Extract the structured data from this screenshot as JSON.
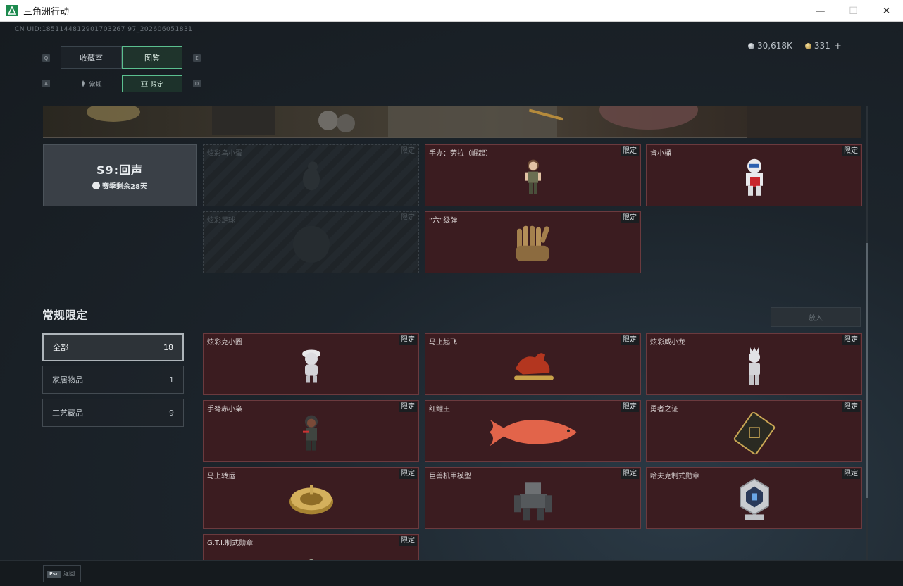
{
  "window": {
    "title": "三角洲行动",
    "minimize": "—",
    "maximize": "☐",
    "close": "✕"
  },
  "header": {
    "uid": "CN UID:1851144812901703267 97_202606051831",
    "silver": "30,618K",
    "gold": "331",
    "plus": "+"
  },
  "tabs": {
    "key_left": "Q",
    "key_right": "E",
    "collection": "收藏室",
    "catalog": "图鉴",
    "sub_key_left": "A",
    "sub_key_right": "D",
    "normal": "常规",
    "limited": "限定"
  },
  "season": {
    "title": "S9:回声",
    "remaining": "赛季剩余28天"
  },
  "tag": "限定",
  "season_items": [
    {
      "name": "炫彩乌小蛋",
      "locked": true
    },
    {
      "name": "手办：劳拉（崛起）",
      "locked": false
    },
    {
      "name": "肯小桶",
      "locked": false
    },
    {
      "name": "炫彩足球",
      "locked": true
    },
    {
      "name": "“六”级弹",
      "locked": false
    }
  ],
  "section": {
    "title": "常规限定",
    "put_button": "放入"
  },
  "filters": [
    {
      "label": "全部",
      "count": "18",
      "active": true
    },
    {
      "label": "家居物品",
      "count": "1",
      "active": false
    },
    {
      "label": "工艺藏品",
      "count": "9",
      "active": false
    }
  ],
  "items": [
    {
      "name": "炫彩克小圈"
    },
    {
      "name": "马上起飞"
    },
    {
      "name": "炫彩威小龙"
    },
    {
      "name": "手弩赤小枭"
    },
    {
      "name": "红鲤王"
    },
    {
      "name": "勇者之证"
    },
    {
      "name": "马上转运"
    },
    {
      "name": "巨兽机甲模型"
    },
    {
      "name": "哈夫克制式勋章"
    },
    {
      "name": "G.T.I.制式勋章"
    }
  ],
  "footer": {
    "esc_key": "Esc",
    "esc_label": "返回"
  }
}
